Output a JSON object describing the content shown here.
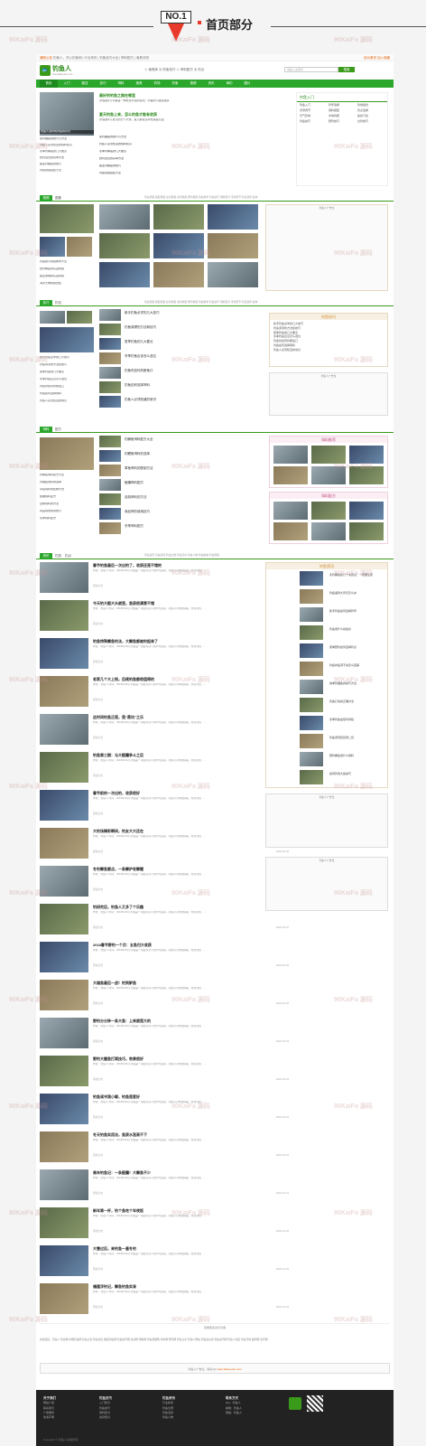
{
  "banner": {
    "no1": "NO.1",
    "title": "首页部分"
  },
  "topbar": {
    "notice_label": "通知公告",
    "notice_text": "钓鱼人，开心钓鱼网 | 行业资讯 | 钓鱼技巧大全 | 饵料配方 | 渔具评测",
    "right_text": "设为首页 加入收藏"
  },
  "header": {
    "site_name": "钓鱼人",
    "site_sub": "www.diaoyuren.com",
    "links": "☆ 渔具库  ▣ 钓鱼技巧  ☆ 饵料配方  ▣ 钓点",
    "search_placeholder": "请输入关键字",
    "search_button": "搜索"
  },
  "nav": [
    "首页",
    "入门",
    "路亚",
    "技巧",
    "饵料",
    "渔具",
    "钓场",
    "钓鱼",
    "视频",
    "资讯",
    "海钓",
    "图片"
  ],
  "sec1": {
    "headlines": [
      {
        "title": "最好的钓鱼之路在哪里",
        "desc": "[钓鱼技巧] 钓鱼是一种修身养性的运动，钓鱼的人越来越多"
      },
      {
        "title": "夏天钓鱼上来，怎么钓鱼才能有收获",
        "desc": "[钓鱼技巧] 夏天的天气炎热，鱼儿都在深水处躲避高温"
      }
    ],
    "list": [
      "夏钓鲤鱼的技巧与方法",
      "钓鱼人必须知道的饵料知识",
      "冬季钓鲫鱼的几大要点",
      "野钓选位的基本方法",
      "路亚钓鳜鱼的技巧",
      "钓鱼线组搭配大全"
    ],
    "right_title": "钓鱼入门",
    "right_list": [
      "钓鱼入门",
      "钓竿选择",
      "钓线组合",
      "浮漂调节",
      "饵料搭配",
      "钓点选择",
      "天气影响",
      "水情判断",
      "鱼的习性",
      "钓鱼技巧",
      "野钓技巧",
      "台钓技巧"
    ],
    "img_caption": "钓鱼人到钓场钓鱼的风景"
  },
  "sec2": {
    "tab": "视频",
    "tab2": "图集",
    "tags": "钓鱼视频  路亚视频  台钓视频  海钓视频  野钓视频  钓鱼教学  钓鱼技巧  饵料配方  浮漂调节  钓点选择  鱼种",
    "list": [
      "钓鱼技巧视频教学大全",
      "野钓鲫鱼的实战视频",
      "路亚翘嘴的实战视频",
      "海钓大物视频合集"
    ],
    "ad": "钓鱼人广告位"
  },
  "sec3": {
    "tab": "技巧",
    "tab2": "钓法",
    "box_title": "钓鱼技巧",
    "items": [
      "新手钓鱼必学的几大技巧",
      "钓鱼调漂的方法和技巧",
      "夏季钓鱼的几大要点",
      "冬季钓鱼应该怎么选位",
      "钓鱼时如何判断鱼口",
      "钓鱼如何选择饵料",
      "钓鱼人必须知道的常识"
    ],
    "ad": "钓鱼人广告位"
  },
  "sec4": {
    "tab": "饵料",
    "tab2": "配方",
    "box1": "饵料推荐",
    "box2": "饵料配方",
    "items": [
      "钓鲫鱼饵料配方大全",
      "钓鲤鱼饵料的选择",
      "草鱼饵料的配制方法",
      "鲢鳙饵料配方",
      "自制饵料的方法",
      "商品饵的使用技巧",
      "冬季饵料配方"
    ]
  },
  "sec5": {
    "tab": "资讯",
    "tab2": "钓技",
    "tab3": "钓点",
    "tags": "钓鱼资讯  钓鱼新闻  钓鱼比赛  钓鱼活动  钓鱼人物  钓鱼故事  钓鱼视频",
    "articles": [
      {
        "title": "春节钓鱼最后一次出钓了，收获还是不错的",
        "date": "2018-02-16"
      },
      {
        "title": "今天钓大鲢大头就是，鱼获很满意不错",
        "date": "2018-02-15"
      },
      {
        "title": "钓鱼特殊鲫鱼钓法，大鲫鱼都被钓起来了",
        "date": "2018-02-14"
      },
      {
        "title": "老家几个大上钩，后续钓鱼都很值得的",
        "date": "2018-02-13"
      },
      {
        "title": "这时间钓鱼正是，是“黑坑”之乐",
        "date": "2018-02-12"
      },
      {
        "title": "钓鱼第三期：与大鲢鳙争斗之后",
        "date": "2018-02-11"
      },
      {
        "title": "春节前的一次出钓，收获很好",
        "date": "2018-02-10"
      },
      {
        "title": "大钓场精彩瞬间，钓友大大还在",
        "date": "2018-02-09"
      },
      {
        "title": "冬钓鲫鱼要点，一条鲫护老鲫鲤",
        "date": "2018-02-08"
      },
      {
        "title": "钓研究后，钓鱼人又多了个乐趣",
        "date": "2018-02-07"
      },
      {
        "title": "2018春节野钓一个月：五鱼归大收获",
        "date": "2018-02-06"
      },
      {
        "title": "大雄鱼最后一战！钓到鲈鱼",
        "date": "2018-02-05"
      },
      {
        "title": "野钓分分钟一条大鱼：上来就是大的",
        "date": "2018-02-04"
      },
      {
        "title": "野钓大鲤鱼打窝技巧，效果很好",
        "date": "2018-02-03"
      },
      {
        "title": "钓鱼读书我小聊，钓鱼是爱好",
        "date": "2018-02-02"
      },
      {
        "title": "冬天钓鱼实用法，鱼获水涨高不下",
        "date": "2018-02-01"
      },
      {
        "title": "周末钓鱼记：一条鲢鳙！大鲫鱼不少",
        "date": "2018-01-31"
      },
      {
        "title": "新年第一杆，钓个鱼吃个年夜饭",
        "date": "2018-01-30"
      },
      {
        "title": "大雪过后，来钓鱼一番冬钓",
        "date": "2018-01-29"
      },
      {
        "title": "福建浮钓记，鲫鱼钓鱼实录",
        "date": "2018-01-28"
      }
    ],
    "desc": "作者：钓鱼人 时间：2018年02月 钓鱼是一项很有意义的户外运动，钓鱼可以陶冶情操，修身养性……",
    "meta": "阅读全文",
    "right_title": "钓鱼资讯",
    "right_items": [
      "冬钓鲫鱼的几个关键点，一定要注意",
      "钓鱼遇到大风天怎么办",
      "新手钓鱼如何选择钓竿",
      "钓鱼用什么线最好",
      "夏季野钓如何选择钓点",
      "钓鱼时鱼漂不动怎么回事",
      "春季钓鲤鱼的技巧方法",
      "钓鱼打窝的正确方法",
      "冬季钓鱼最佳时间段",
      "钓鱼调漂四目调二目",
      "野钓鲫鱼用什么饵料",
      "如何钓到大鱼技巧"
    ],
    "ad1": "钓鱼人广告位",
    "ad2": "钓鱼人广告位"
  },
  "more": "查看更多资讯文章",
  "links": "友情链接：钓鱼人  钓鱼网  中国钓鱼网  钓鱼之家  钓鱼论坛  路亚钓鱼网  钓鱼技巧网  渔具网  饵料网  钓鱼视频网  海钓网  野钓网  钓友之家  钓鱼人网站  钓鱼爱好者  钓鱼资讯网  钓鱼人社区  钓鱼天地  垂钓网  渔乐网",
  "bottom_ad": {
    "text": "钓鱼人广告位，联系QQ",
    "link": "www.diaoyuren.com"
  },
  "footer": {
    "col1": {
      "title": "关于我们",
      "items": [
        "网站介绍",
        "联系我们",
        "广告服务",
        "免责声明"
      ]
    },
    "col2": {
      "title": "钓鱼技巧",
      "items": [
        "入门知识",
        "钓鱼技巧",
        "饵料配方",
        "渔具知识"
      ]
    },
    "col3": {
      "title": "钓鱼资讯",
      "items": [
        "行业新闻",
        "钓鱼比赛",
        "钓鱼活动",
        "钓鱼人物"
      ]
    },
    "col4": {
      "title": "联系方式",
      "items": [
        "QQ：钓鱼人",
        "邮箱：钓鱼人",
        "微信：钓鱼人"
      ]
    },
    "copyright": "Copyright © 钓鱼人 版权所有"
  },
  "watermark": "90KaiFa 源码"
}
